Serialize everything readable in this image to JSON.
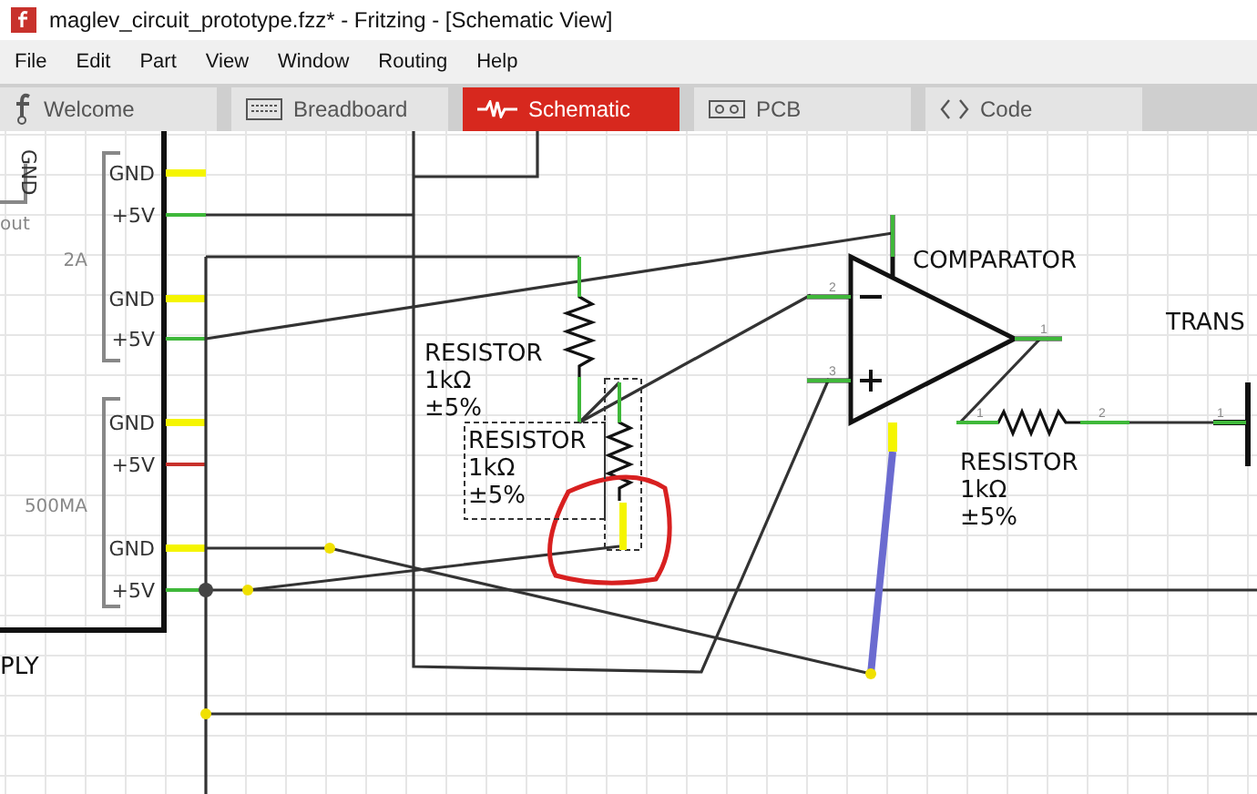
{
  "window": {
    "title": "maglev_circuit_prototype.fzz* - Fritzing - [Schematic View]"
  },
  "menu": [
    "File",
    "Edit",
    "Part",
    "View",
    "Window",
    "Routing",
    "Help"
  ],
  "tabs": [
    {
      "label": "Welcome",
      "kind": "welcome",
      "selected": false
    },
    {
      "label": "Breadboard",
      "kind": "breadboard",
      "selected": false
    },
    {
      "label": "Schematic",
      "kind": "schematic",
      "selected": true
    },
    {
      "label": "PCB",
      "kind": "pcb",
      "selected": false
    },
    {
      "label": "Code",
      "kind": "code",
      "selected": false
    }
  ],
  "schematic": {
    "power_supply": {
      "cut_labels": [
        "GND",
        "out",
        "PLY"
      ],
      "groups": [
        "2A",
        "500MA"
      ],
      "pins": [
        {
          "label": "GND",
          "color": "#f5f500"
        },
        {
          "label": "+5V",
          "color": "#3fb83a"
        },
        {
          "label": "GND",
          "color": "#f5f500"
        },
        {
          "label": "+5V",
          "color": "#3fb83a"
        },
        {
          "label": "GND",
          "color": "#f5f500"
        },
        {
          "label": "+5V",
          "color": "#c8322c"
        },
        {
          "label": "GND",
          "color": "#f5f500"
        },
        {
          "label": "+5V",
          "color": "#3fb83a"
        }
      ]
    },
    "resistors": [
      {
        "lines": [
          "RESISTOR",
          "1kΩ",
          "±5%"
        ]
      },
      {
        "lines": [
          "RESISTOR",
          "1kΩ",
          "±5%"
        ]
      },
      {
        "lines": [
          "RESISTOR",
          "1kΩ",
          "±5%"
        ],
        "pin_numbers": [
          "1",
          "2"
        ]
      }
    ],
    "comparator": {
      "label": "COMPARATOR",
      "pin_numbers": [
        "2",
        "3",
        "1"
      ]
    },
    "transistor": {
      "label": "TRANS",
      "pin_numbers": [
        "1"
      ]
    }
  }
}
